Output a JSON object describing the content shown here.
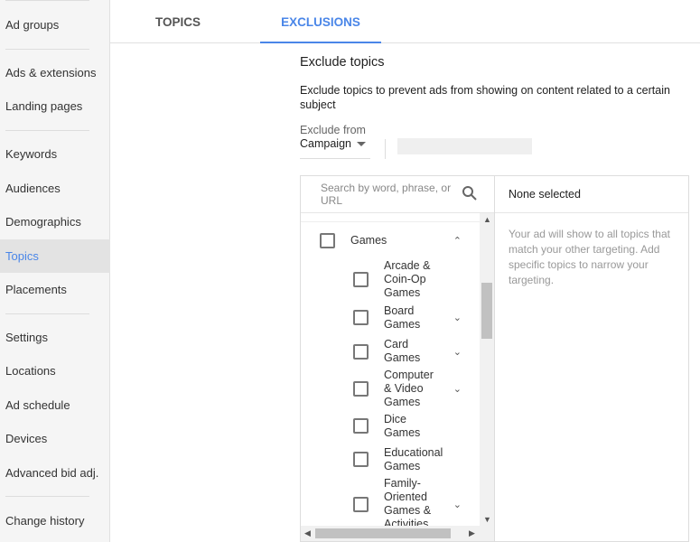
{
  "sidebar": {
    "items": [
      {
        "label": "Ad groups"
      },
      {
        "label": "Ads & extensions"
      },
      {
        "label": "Landing pages"
      },
      {
        "label": "Keywords"
      },
      {
        "label": "Audiences"
      },
      {
        "label": "Demographics"
      },
      {
        "label": "Topics",
        "active": true
      },
      {
        "label": "Placements"
      },
      {
        "label": "Settings"
      },
      {
        "label": "Locations"
      },
      {
        "label": "Ad schedule"
      },
      {
        "label": "Devices"
      },
      {
        "label": "Advanced bid adj."
      },
      {
        "label": "Change history"
      }
    ]
  },
  "tabs": [
    {
      "label": "TOPICS"
    },
    {
      "label": "EXCLUSIONS",
      "active": true
    }
  ],
  "main": {
    "title": "Exclude topics",
    "description": "Exclude topics to prevent ads from showing on content related to a certain subject",
    "exclude_from_label": "Exclude from",
    "exclude_from_value": "Campaign",
    "search_placeholder": "Search by word, phrase, or URL",
    "none_selected": "None selected",
    "hint": "Your ad will show to all topics that match your other targeting. Add specific topics to narrow your targeting.",
    "tree": {
      "parent": "Games",
      "children": [
        {
          "label": "Arcade & Coin-Op Games",
          "expandable": false
        },
        {
          "label": "Board Games",
          "expandable": true
        },
        {
          "label": "Card Games",
          "expandable": true
        },
        {
          "label": "Computer & Video Games",
          "expandable": true
        },
        {
          "label": "Dice Games",
          "expandable": false
        },
        {
          "label": "Educational Games",
          "expandable": false
        },
        {
          "label": "Family-Oriented Games & Activities",
          "expandable": true
        }
      ]
    }
  },
  "colors": {
    "accent": "#4a86e8"
  }
}
